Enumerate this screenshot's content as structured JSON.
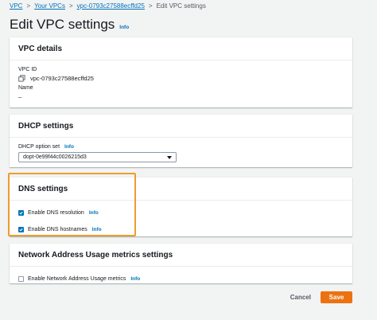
{
  "breadcrumb": {
    "items": [
      "VPC",
      "Your VPCs",
      "vpc-0793c27588ecffd25"
    ],
    "separator": ">",
    "current": "Edit VPC settings"
  },
  "page": {
    "title": "Edit VPC settings",
    "info": "Info"
  },
  "vpc_details": {
    "header": "VPC details",
    "vpc_id_label": "VPC ID",
    "vpc_id_value": "vpc-0793c27588ecffd25",
    "name_label": "Name",
    "name_value": "–"
  },
  "dhcp_settings": {
    "header": "DHCP settings",
    "option_set_label": "DHCP option set",
    "info": "Info",
    "option_set_value": "dopt-0e99f44c0026215d3"
  },
  "dns_settings": {
    "header": "DNS settings",
    "resolution_label": "Enable DNS resolution",
    "resolution_checked": true,
    "hostnames_label": "Enable DNS hostnames",
    "hostnames_checked": true,
    "info": "Info"
  },
  "nau_settings": {
    "header": "Network Address Usage metrics settings",
    "enable_label": "Enable Network Address Usage metrics",
    "enable_checked": false,
    "info": "Info"
  },
  "footer": {
    "cancel_label": "Cancel",
    "save_label": "Save"
  },
  "colors": {
    "link": "#0073bb",
    "primary_button": "#ec7211",
    "highlight": "#ec9d2d",
    "checkbox": "#0073bb"
  },
  "icons": {
    "copy": "copy-icon",
    "dropdown": "caret-down-icon",
    "check": "check-icon"
  }
}
